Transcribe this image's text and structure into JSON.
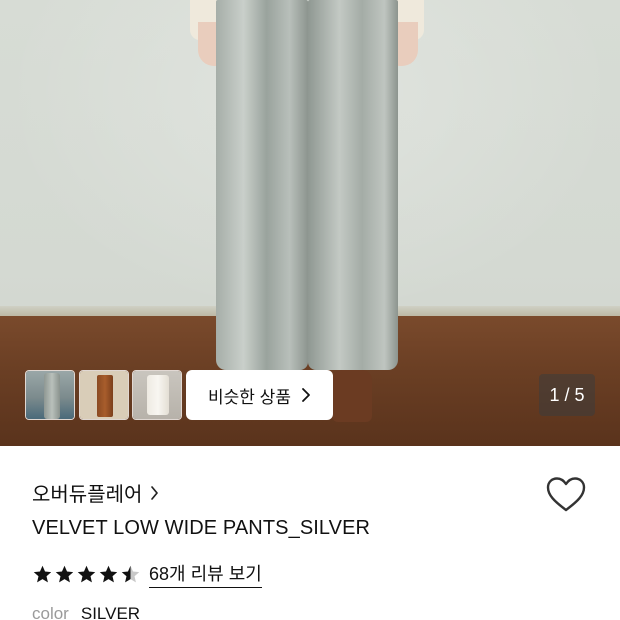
{
  "hero": {
    "thumbnails": [
      {
        "name": "thumbnail-1",
        "scene": "model outdoors"
      },
      {
        "name": "thumbnail-2",
        "scene": "brown pants flat"
      },
      {
        "name": "thumbnail-3",
        "scene": "white pants on model"
      }
    ],
    "similar_button_label": "비슷한 상품",
    "page_counter": "1 / 5"
  },
  "product": {
    "brand": "오버듀플레어",
    "title": "VELVET LOW WIDE PANTS_SILVER",
    "rating": 4.5,
    "review_link": "68개 리뷰 보기",
    "color_label": "color",
    "color_value": "SILVER"
  },
  "icons": {
    "brand_arrow": "chevron-right-icon",
    "similar_arrow": "chevron-right-icon",
    "wishlist": "heart-outline-icon",
    "star": "star-icon"
  },
  "colors": {
    "star_fill": "#111111",
    "star_empty": "#c8c8c8"
  }
}
